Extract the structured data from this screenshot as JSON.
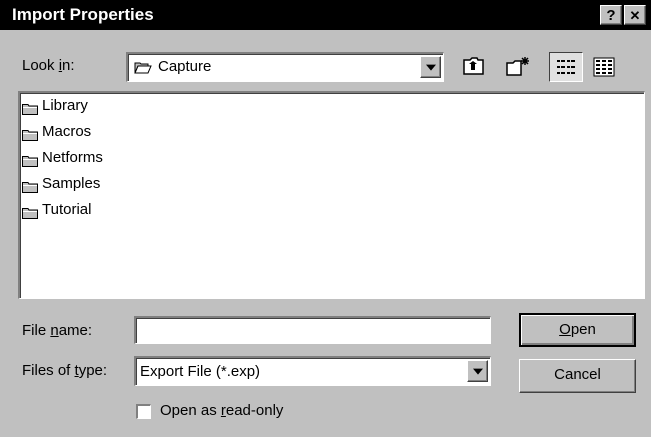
{
  "window": {
    "title": "Import Properties",
    "help_label": "?",
    "close_label": "✕"
  },
  "look_in": {
    "label_pre": "Look ",
    "label_key": "i",
    "label_post": "n:",
    "value": "Capture"
  },
  "toolbar": {
    "up_folder_icon": "up-one-level",
    "new_folder_icon": "create-new-folder",
    "list_view_icon": "list-view",
    "details_view_icon": "details-view"
  },
  "files": [
    {
      "name": "Library",
      "icon": "folder"
    },
    {
      "name": "Macros",
      "icon": "folder"
    },
    {
      "name": "Netforms",
      "icon": "folder"
    },
    {
      "name": "Samples",
      "icon": "folder"
    },
    {
      "name": "Tutorial",
      "icon": "folder"
    }
  ],
  "file_name": {
    "label_pre": "File ",
    "label_key": "n",
    "label_post": "ame:",
    "value": ""
  },
  "file_type": {
    "label_pre": "Files of ",
    "label_key": "t",
    "label_post": "ype:",
    "value": "Export File (*.exp)"
  },
  "buttons": {
    "open_key": "O",
    "open_rest": "pen",
    "cancel": "Cancel"
  },
  "read_only": {
    "label_pre": "Open as ",
    "label_key": "r",
    "label_post": "ead-only",
    "checked": false
  },
  "colors": {
    "titlebar": "#000000",
    "face": "#c0c0c0",
    "window": "#ffffff"
  }
}
